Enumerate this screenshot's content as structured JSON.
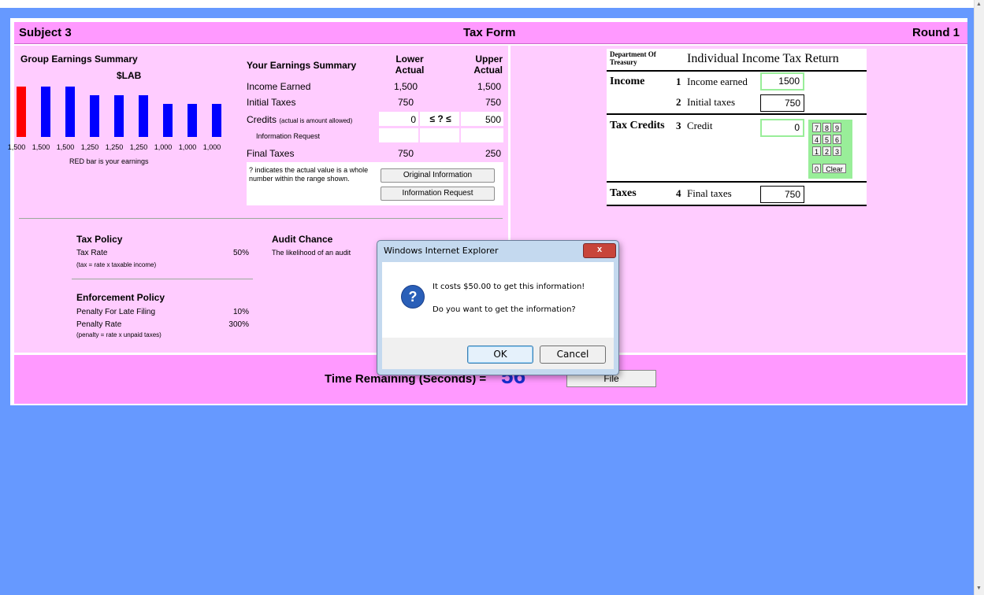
{
  "header": {
    "subject": "Subject 3",
    "title": "Tax Form",
    "round": "Round 1"
  },
  "group_earnings": {
    "title": "Group Earnings Summary",
    "currency": "$LAB",
    "caption": "RED bar is your earnings",
    "colors": {
      "own": "#ff0000",
      "others": "#0000ff"
    },
    "chart_data": {
      "type": "bar",
      "categories": [
        "1,500",
        "1,500",
        "1,500",
        "1,250",
        "1,250",
        "1,250",
        "1,000",
        "1,000",
        "1,000"
      ],
      "values": [
        1500,
        1500,
        1500,
        1250,
        1250,
        1250,
        1000,
        1000,
        1000
      ],
      "highlight_index": 0,
      "ylim": [
        0,
        1600
      ]
    }
  },
  "your_earnings": {
    "title": "Your Earnings Summary",
    "col_lower": "Lower Actual",
    "col_upper": "Upper Actual",
    "rows": {
      "income": {
        "label": "Income Earned",
        "lower": "1,500",
        "upper": "1,500"
      },
      "initial": {
        "label": "Initial Taxes",
        "lower": "750",
        "upper": "750"
      },
      "credits": {
        "label": "Credits",
        "note": "(actual is amount allowed)",
        "lower": "0",
        "mid": "≤ ? ≤",
        "upper": "500"
      },
      "info": {
        "label": "Information Request"
      },
      "final": {
        "label": "Final Taxes",
        "lower": "750",
        "upper": "250"
      }
    },
    "note": "? indicates the actual value is a whole number within the range shown.",
    "btn_original": "Original Information",
    "btn_request": "Information Request"
  },
  "tax_policy": {
    "title": "Tax Policy",
    "rate_label": "Tax Rate",
    "rate_value": "50%",
    "rate_note": "(tax = rate x taxable income)"
  },
  "audit": {
    "title": "Audit Chance",
    "text": "The likelihood of an audit"
  },
  "enforcement": {
    "title": "Enforcement Policy",
    "late_label": "Penalty For Late Filing",
    "late_value": "10%",
    "penalty_label": "Penalty Rate",
    "penalty_value": "300%",
    "penalty_note": "(penalty = rate x unpaid taxes)"
  },
  "form": {
    "dept": "Department Of Treasury",
    "title": "Individual Income Tax Return",
    "income_section": "Income",
    "line1_num": "1",
    "line1_label": "Income earned",
    "line1_value": "1500",
    "line2_num": "2",
    "line2_label": "Initial taxes",
    "line2_value": "750",
    "credits_section": "Tax Credits",
    "line3_num": "3",
    "line3_label": "Credit",
    "line3_value": "0",
    "taxes_section": "Taxes",
    "line4_num": "4",
    "line4_label": "Final taxes",
    "line4_value": "750",
    "keys": [
      "7",
      "8",
      "9",
      "4",
      "5",
      "6",
      "1",
      "2",
      "3",
      "0"
    ],
    "key_clear": "Clear"
  },
  "bottom": {
    "time_label": "Time Remaining (Seconds) =",
    "time_value": "56",
    "file_button": "File"
  },
  "dialog": {
    "title": "Windows Internet Explorer",
    "line1": "It costs $50.00 to get this information!",
    "line2": "Do you want to get the information?",
    "ok": "OK",
    "cancel": "Cancel",
    "close": "x"
  }
}
